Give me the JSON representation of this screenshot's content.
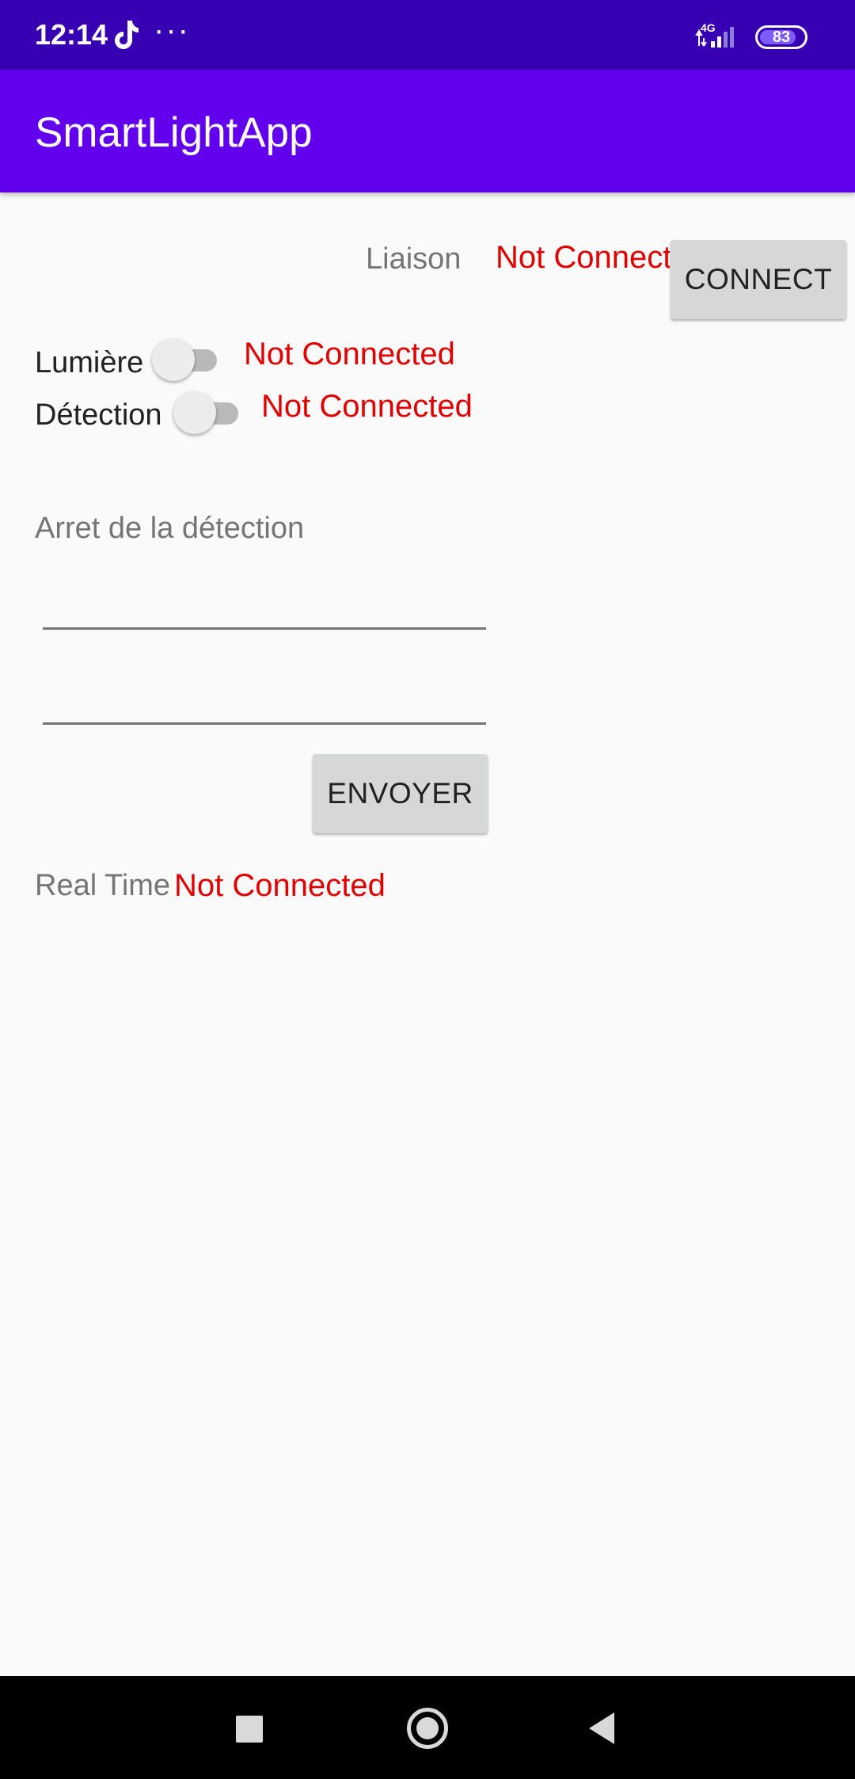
{
  "status_bar": {
    "time": "12:14",
    "more_indicator": "···",
    "network_type": "4G",
    "battery_percent": 83,
    "battery_label": "83",
    "icons": [
      "tiktok-icon",
      "signal-icon",
      "battery-icon"
    ]
  },
  "app_bar": {
    "title": "SmartLightApp",
    "color": "#6200ee"
  },
  "connection": {
    "label": "Liaison",
    "status": "Not Connected",
    "button_label": "CONNECT"
  },
  "toggles": [
    {
      "label": "Lumière",
      "status": "Not Connected",
      "checked": false
    },
    {
      "label": "Détection",
      "status": "Not Connected",
      "checked": false
    }
  ],
  "detection_stop": {
    "label": "Arret de la détection",
    "input_1_value": "",
    "input_2_value": "",
    "send_button_label": "ENVOYER"
  },
  "real_time": {
    "label": "Real Time",
    "status": "Not Connected"
  },
  "colors": {
    "status_bar": "#3700b3",
    "status_red": "#e00000",
    "button_gray": "#d6d7d7"
  },
  "nav_bar": {
    "buttons": [
      "recents-icon",
      "home-icon",
      "back-icon"
    ]
  }
}
